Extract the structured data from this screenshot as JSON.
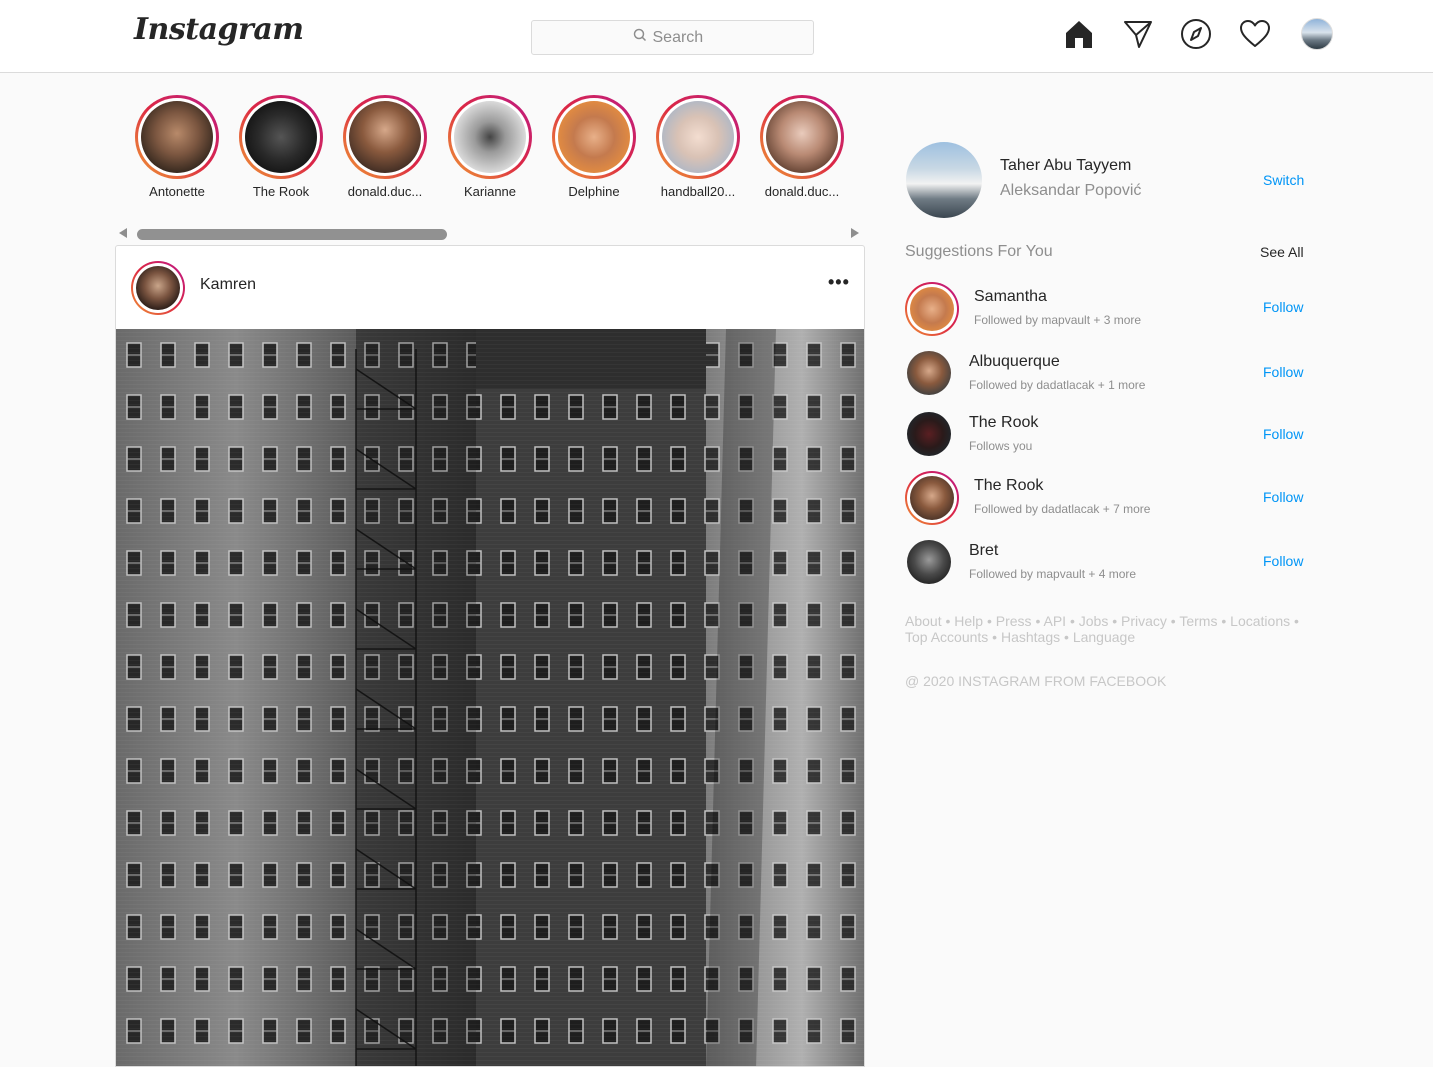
{
  "header": {
    "logo": "Instagram",
    "search_placeholder": "Search"
  },
  "stories": [
    {
      "name": "Antonette"
    },
    {
      "name": "The Rook"
    },
    {
      "name": "donald.duc..."
    },
    {
      "name": "Karianne"
    },
    {
      "name": "Delphine"
    },
    {
      "name": "handball20..."
    },
    {
      "name": "donald.duc..."
    }
  ],
  "post": {
    "username": "Kamren",
    "more": "•••"
  },
  "profile": {
    "username": "Taher Abu Tayyem",
    "full_name": "Aleksandar Popović",
    "switch_label": "Switch"
  },
  "suggestions": {
    "title": "Suggestions For You",
    "see_all": "See All",
    "follow_label": "Follow",
    "items": [
      {
        "name": "Samantha",
        "sub": "Followed by mapvault + 3 more"
      },
      {
        "name": "Albuquerque",
        "sub": "Followed by dadatlacak + 1 more"
      },
      {
        "name": "The Rook",
        "sub": "Follows you"
      },
      {
        "name": "The Rook",
        "sub": "Followed by dadatlacak + 7 more"
      },
      {
        "name": "Bret",
        "sub": "Followed by mapvault + 4 more"
      }
    ]
  },
  "footer": {
    "links": [
      "About",
      "Help",
      "Press",
      "API",
      "Jobs",
      "Privacy",
      "Terms",
      "Locations",
      "Top Accounts",
      "Hashtags",
      "Language"
    ],
    "copyright": "@ 2020 INSTAGRAM FROM FACEBOOK"
  }
}
